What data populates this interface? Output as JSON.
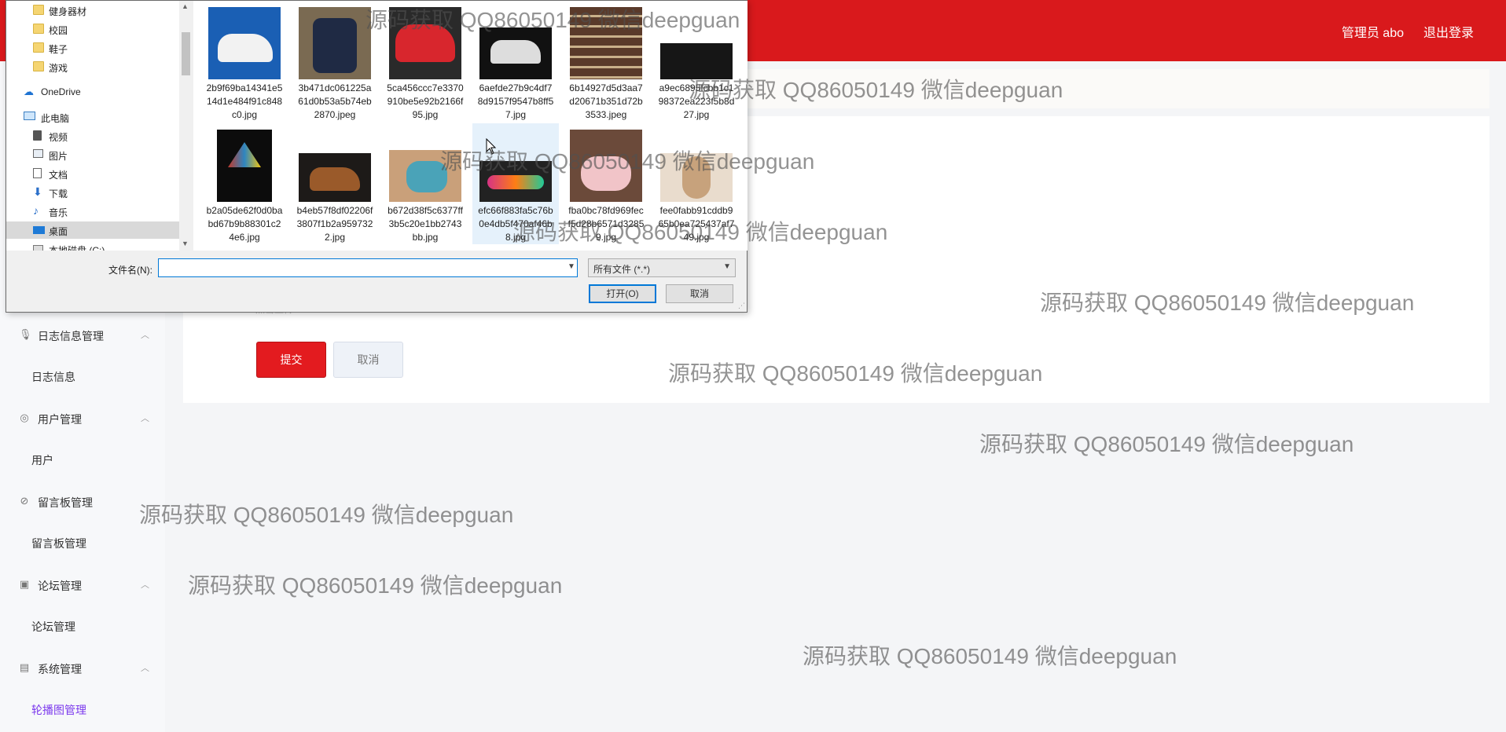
{
  "topbar": {
    "user": "管理员 abo",
    "logout": "退出登录",
    "color": "#d9191c"
  },
  "sidebar": {
    "groups": [
      {
        "label": "日志信息管理",
        "icon": "mic-icon",
        "item": "日志信息"
      },
      {
        "label": "用户管理",
        "icon": "user-ring-icon",
        "item": "用户"
      },
      {
        "label": "留言板管理",
        "icon": "compass-icon",
        "item": "留言板管理"
      },
      {
        "label": "论坛管理",
        "icon": "clipboard-icon",
        "item": "论坛管理"
      },
      {
        "label": "系统管理",
        "icon": "list-icon",
        "item": "轮播图管理"
      }
    ]
  },
  "form": {
    "hint": "点击上传",
    "submit": "提交",
    "cancel": "取消",
    "accent": "#e31b1f"
  },
  "dialog": {
    "tree": [
      {
        "label": "健身器材",
        "icon": "folder-icon"
      },
      {
        "label": "校园",
        "icon": "folder-icon"
      },
      {
        "label": "鞋子",
        "icon": "folder-icon"
      },
      {
        "label": "游戏",
        "icon": "folder-icon"
      },
      {
        "label": "OneDrive",
        "icon": "cloud-icon"
      },
      {
        "label": "此电脑",
        "icon": "computer-icon"
      },
      {
        "label": "视频",
        "icon": "video-icon"
      },
      {
        "label": "图片",
        "icon": "picture-icon"
      },
      {
        "label": "文档",
        "icon": "document-icon"
      },
      {
        "label": "下载",
        "icon": "download-icon"
      },
      {
        "label": "音乐",
        "icon": "music-icon"
      },
      {
        "label": "桌面",
        "icon": "desktop-icon"
      },
      {
        "label": "本地磁盘 (C:)",
        "icon": "drive-icon"
      }
    ],
    "files": [
      {
        "name": "2b9f69ba14341e514d1e484f91c848c0.jpg"
      },
      {
        "name": "3b471dc061225a61d0b53a5b74eb2870.jpeg"
      },
      {
        "name": "5ca456ccc7e3370910be5e92b2166f95.jpg"
      },
      {
        "name": "6aefde27b9c4df78d9157f9547b8ff57.jpg"
      },
      {
        "name": "6b14927d5d3aa7d20671b351d72b3533.jpeg"
      },
      {
        "name": "a9ec6895fcbb1c198372ea223f5b8d27.jpg"
      },
      {
        "name": "b2a05de62f0d0babd67b9b88301c24e6.jpg"
      },
      {
        "name": "b4eb57f8df02206f3807f1b2a9597322.jpg"
      },
      {
        "name": "b672d38f5c6377ff3b5c20e1bb2743bb.jpg"
      },
      {
        "name": "efc66f883fa5c76b0e4db5f470af46b8.jpg"
      },
      {
        "name": "fba0bc78fd969fecf5d28b6571d32859.jpg"
      },
      {
        "name": "fee0fabb91cddb965b0ea725437af749.jpg"
      }
    ],
    "filename_label": "文件名(N):",
    "filename_value": "",
    "filetype": "所有文件 (*.*)",
    "open": "打开(O)",
    "cancel": "取消"
  },
  "watermark": "源码获取 QQ86050149 微信deepguan"
}
